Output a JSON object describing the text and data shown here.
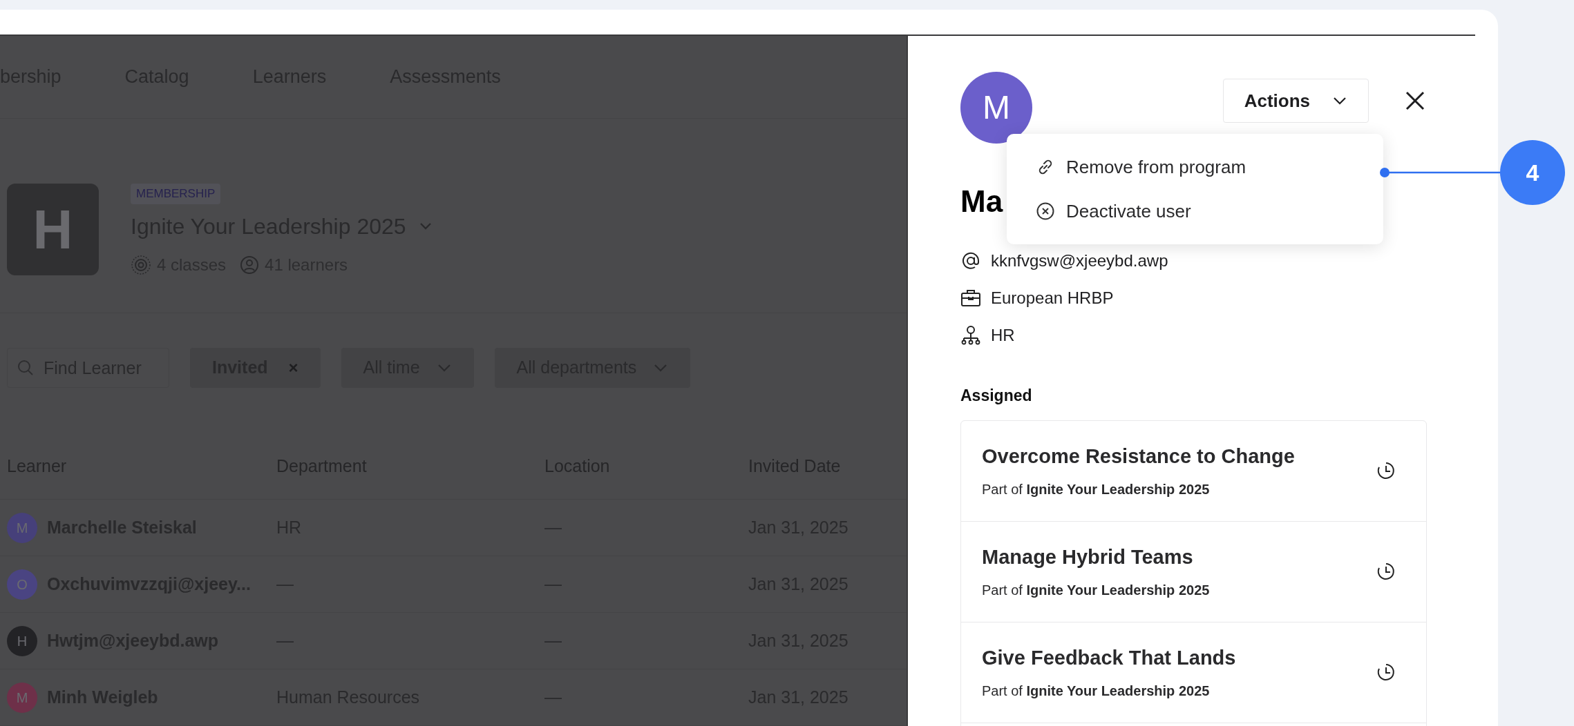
{
  "tabs": [
    {
      "label": "bership"
    },
    {
      "label": "Catalog"
    },
    {
      "label": "Learners"
    },
    {
      "label": "Assessments"
    }
  ],
  "program": {
    "badge": "MEMBERSHIP",
    "logo_letter": "H",
    "title": "Ignite Your Leadership 2025",
    "classes": "4 classes",
    "learners": "41 learners"
  },
  "filters": {
    "search_placeholder": "Find Learner",
    "status_chip": "Invited",
    "status_chip_close": "×",
    "time": "All time",
    "department": "All departments"
  },
  "table": {
    "columns": [
      "Learner",
      "Department",
      "Location",
      "Invited Date"
    ],
    "rows": [
      {
        "initial": "M",
        "color": "#46407a",
        "learner": "Marchelle Steiskal",
        "department": "HR",
        "location": "—",
        "invited_date": "Jan 31, 2025"
      },
      {
        "initial": "O",
        "color": "#4a4482",
        "learner": "Oxchuvimvzzqji@xjeey...",
        "department": "—",
        "location": "—",
        "invited_date": "Jan 31, 2025"
      },
      {
        "initial": "H",
        "color": "#232326",
        "learner": "Hwtjm@xjeeybd.awp",
        "department": "—",
        "location": "—",
        "invited_date": "Jan 31, 2025"
      },
      {
        "initial": "M",
        "color": "#6e3049",
        "learner": "Minh Weigleb",
        "department": "Human Resources",
        "location": "—",
        "invited_date": "Jan 31, 2025"
      }
    ]
  },
  "drawer": {
    "avatar_letter": "M",
    "name": "Ma",
    "actions_button": "Actions",
    "actions_menu": [
      {
        "kind": "link",
        "label": "Remove from program"
      },
      {
        "kind": "cancel",
        "label": "Deactivate user"
      }
    ],
    "details": [
      {
        "kind": "email",
        "text": "kknfvgsw@xjeeybd.awp"
      },
      {
        "kind": "job",
        "text": "European HRBP"
      },
      {
        "kind": "department",
        "text": "HR"
      }
    ],
    "assigned_heading": "Assigned",
    "assigned": [
      {
        "title": "Overcome Resistance to Change",
        "subtitle": "Part of **Ignite Your Leadership 2025**"
      },
      {
        "title": "Manage Hybrid Teams",
        "subtitle": "Part of **Ignite Your Leadership 2025**"
      },
      {
        "title": "Give Feedback That Lands",
        "subtitle": "Part of **Ignite Your Leadership 2025**"
      }
    ]
  },
  "callout": {
    "number": "4"
  }
}
